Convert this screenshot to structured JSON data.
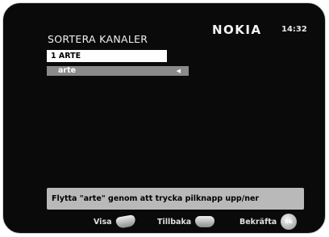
{
  "header": {
    "title": "SORTERA KANALER",
    "brand": "NOKIA",
    "clock": "14:32"
  },
  "list": {
    "selected_row": "1 ARTE",
    "moving_row": "arte",
    "moving_arrow_icon": "left-arrow-icon"
  },
  "hint": "Flytta \"arte\" genom att trycka pilknapp upp/ner",
  "footer": {
    "visa_label": "Visa",
    "tillbaka_label": "Tillbaka",
    "bekrafta_label": "Bekräfta",
    "ok_label": "ok"
  },
  "colors": {
    "screen_bg": "#0a0a0a",
    "selected_bg": "#ffffff",
    "moving_bg": "#8a8a8a",
    "hint_bg": "#b9b9b9"
  }
}
